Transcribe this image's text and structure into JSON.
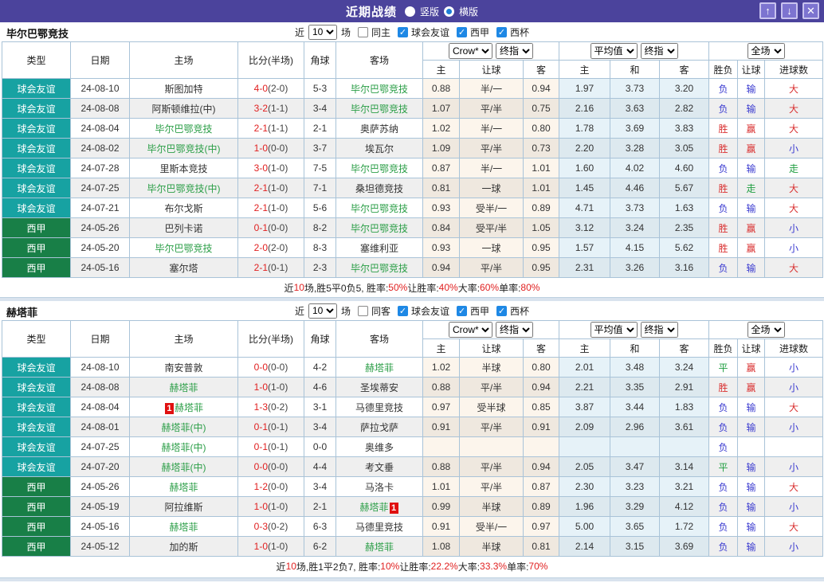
{
  "titlebar": {
    "title": "近期战绩",
    "radio_vertical": "竖版",
    "radio_horizontal": "横版",
    "up_icon": "↑",
    "down_icon": "↓",
    "close_icon": "✕"
  },
  "filters": {
    "near": "近",
    "count": "10",
    "games": "场",
    "friendly": "球会友谊",
    "laliga": "西甲",
    "copa": "西杯"
  },
  "table_header": {
    "type": "类型",
    "date": "日期",
    "home": "主场",
    "score": "比分(半场)",
    "corner": "角球",
    "away": "客场",
    "crow_select": "Crow*",
    "final_select": "终指",
    "avg_select": "平均值",
    "full_select": "全场",
    "h": "主",
    "handicap": "让球",
    "a": "客",
    "d": "和",
    "wl": "胜负",
    "goals": "进球数"
  },
  "sections": [
    {
      "team": "毕尔巴鄂竞技",
      "same_label": "同主",
      "rows": [
        {
          "lg": "球会友谊",
          "lgc": "f",
          "date": "24-08-10",
          "home": "斯图加特",
          "hg": 0,
          "ft": "4-0",
          "ht": "(2-0)",
          "cor": "5-3",
          "away": "毕尔巴鄂竞技",
          "ag": 1,
          "crow": [
            "0.88",
            "半/一",
            "0.94"
          ],
          "avg": [
            "1.97",
            "3.73",
            "3.20"
          ],
          "res": [
            [
              "负",
              "b"
            ],
            [
              "输",
              "b"
            ],
            [
              "大",
              "r"
            ]
          ]
        },
        {
          "lg": "球会友谊",
          "lgc": "f",
          "date": "24-08-08",
          "home": "阿斯顿维拉(中)",
          "hg": 0,
          "ft": "3-2",
          "ht": "(1-1)",
          "cor": "3-4",
          "away": "毕尔巴鄂竞技",
          "ag": 1,
          "crow": [
            "1.07",
            "平/半",
            "0.75"
          ],
          "avg": [
            "2.16",
            "3.63",
            "2.82"
          ],
          "res": [
            [
              "负",
              "b"
            ],
            [
              "输",
              "b"
            ],
            [
              "大",
              "r"
            ]
          ]
        },
        {
          "lg": "球会友谊",
          "lgc": "f",
          "date": "24-08-04",
          "home": "毕尔巴鄂竞技",
          "hg": 1,
          "ft": "2-1",
          "ht": "(1-1)",
          "cor": "2-1",
          "away": "奥萨苏纳",
          "ag": 0,
          "crow": [
            "1.02",
            "半/一",
            "0.80"
          ],
          "avg": [
            "1.78",
            "3.69",
            "3.83"
          ],
          "res": [
            [
              "胜",
              "r"
            ],
            [
              "赢",
              "r"
            ],
            [
              "大",
              "r"
            ]
          ]
        },
        {
          "lg": "球会友谊",
          "lgc": "f",
          "date": "24-08-02",
          "home": "毕尔巴鄂竞技(中)",
          "hg": 1,
          "ft": "1-0",
          "ht": "(0-0)",
          "cor": "3-7",
          "away": "埃瓦尔",
          "ag": 0,
          "crow": [
            "1.09",
            "平/半",
            "0.73"
          ],
          "avg": [
            "2.20",
            "3.28",
            "3.05"
          ],
          "res": [
            [
              "胜",
              "r"
            ],
            [
              "赢",
              "r"
            ],
            [
              "小",
              "b"
            ]
          ]
        },
        {
          "lg": "球会友谊",
          "lgc": "f",
          "date": "24-07-28",
          "home": "里斯本竞技",
          "hg": 0,
          "ft": "3-0",
          "ht": "(1-0)",
          "cor": "7-5",
          "away": "毕尔巴鄂竞技",
          "ag": 1,
          "crow": [
            "0.87",
            "半/一",
            "1.01"
          ],
          "avg": [
            "1.60",
            "4.02",
            "4.60"
          ],
          "res": [
            [
              "负",
              "b"
            ],
            [
              "输",
              "b"
            ],
            [
              "走",
              "g"
            ]
          ]
        },
        {
          "lg": "球会友谊",
          "lgc": "f",
          "date": "24-07-25",
          "home": "毕尔巴鄂竞技(中)",
          "hg": 1,
          "ft": "2-1",
          "ht": "(1-0)",
          "cor": "7-1",
          "away": "桑坦德竞技",
          "ag": 0,
          "crow": [
            "0.81",
            "一球",
            "1.01"
          ],
          "avg": [
            "1.45",
            "4.46",
            "5.67"
          ],
          "res": [
            [
              "胜",
              "r"
            ],
            [
              "走",
              "g"
            ],
            [
              "大",
              "r"
            ]
          ]
        },
        {
          "lg": "球会友谊",
          "lgc": "f",
          "date": "24-07-21",
          "home": "布尔戈斯",
          "hg": 0,
          "ft": "2-1",
          "ht": "(1-0)",
          "cor": "5-6",
          "away": "毕尔巴鄂竞技",
          "ag": 1,
          "crow": [
            "0.93",
            "受半/一",
            "0.89"
          ],
          "avg": [
            "4.71",
            "3.73",
            "1.63"
          ],
          "res": [
            [
              "负",
              "b"
            ],
            [
              "输",
              "b"
            ],
            [
              "大",
              "r"
            ]
          ]
        },
        {
          "lg": "西甲",
          "lgc": "l",
          "date": "24-05-26",
          "home": "巴列卡诺",
          "hg": 0,
          "ft": "0-1",
          "ht": "(0-0)",
          "cor": "8-2",
          "away": "毕尔巴鄂竞技",
          "ag": 1,
          "crow": [
            "0.84",
            "受平/半",
            "1.05"
          ],
          "avg": [
            "3.12",
            "3.24",
            "2.35"
          ],
          "res": [
            [
              "胜",
              "r"
            ],
            [
              "赢",
              "r"
            ],
            [
              "小",
              "b"
            ]
          ]
        },
        {
          "lg": "西甲",
          "lgc": "l",
          "date": "24-05-20",
          "home": "毕尔巴鄂竞技",
          "hg": 1,
          "ft": "2-0",
          "ht": "(2-0)",
          "cor": "8-3",
          "away": "塞维利亚",
          "ag": 0,
          "crow": [
            "0.93",
            "一球",
            "0.95"
          ],
          "avg": [
            "1.57",
            "4.15",
            "5.62"
          ],
          "res": [
            [
              "胜",
              "r"
            ],
            [
              "赢",
              "r"
            ],
            [
              "小",
              "b"
            ]
          ]
        },
        {
          "lg": "西甲",
          "lgc": "l",
          "date": "24-05-16",
          "home": "塞尔塔",
          "hg": 0,
          "ft": "2-1",
          "ht": "(0-1)",
          "cor": "2-3",
          "away": "毕尔巴鄂竞技",
          "ag": 1,
          "crow": [
            "0.94",
            "平/半",
            "0.95"
          ],
          "avg": [
            "2.31",
            "3.26",
            "3.16"
          ],
          "res": [
            [
              "负",
              "b"
            ],
            [
              "输",
              "b"
            ],
            [
              "大",
              "r"
            ]
          ]
        }
      ],
      "summary": [
        [
          "近",
          ""
        ],
        [
          "10",
          "r"
        ],
        [
          "场,胜5平0负5, 胜率:",
          ""
        ],
        [
          "50%",
          "r"
        ],
        [
          " 让胜率:",
          ""
        ],
        [
          "40%",
          "r"
        ],
        [
          " 大率:",
          ""
        ],
        [
          "60%",
          "r"
        ],
        [
          " 单率:",
          ""
        ],
        [
          "80%",
          "r"
        ]
      ]
    },
    {
      "team": "赫塔菲",
      "same_label": "同客",
      "rows": [
        {
          "lg": "球会友谊",
          "lgc": "f",
          "date": "24-08-10",
          "home": "南安普敦",
          "hg": 0,
          "ft": "0-0",
          "ht": "(0-0)",
          "cor": "4-2",
          "away": "赫塔菲",
          "ag": 1,
          "crow": [
            "1.02",
            "半球",
            "0.80"
          ],
          "avg": [
            "2.01",
            "3.48",
            "3.24"
          ],
          "res": [
            [
              "平",
              "g"
            ],
            [
              "赢",
              "r"
            ],
            [
              "小",
              "b"
            ]
          ]
        },
        {
          "lg": "球会友谊",
          "lgc": "f",
          "date": "24-08-08",
          "home": "赫塔菲",
          "hg": 1,
          "ft": "1-0",
          "ht": "(1-0)",
          "cor": "4-6",
          "away": "圣埃蒂安",
          "ag": 0,
          "crow": [
            "0.88",
            "平/半",
            "0.94"
          ],
          "avg": [
            "2.21",
            "3.35",
            "2.91"
          ],
          "res": [
            [
              "胜",
              "r"
            ],
            [
              "赢",
              "r"
            ],
            [
              "小",
              "b"
            ]
          ]
        },
        {
          "lg": "球会友谊",
          "lgc": "f",
          "date": "24-08-04",
          "home": "赫塔菲",
          "hg": 1,
          "hbadge": "1",
          "ft": "1-3",
          "ht": "(0-2)",
          "cor": "3-1",
          "away": "马德里竞技",
          "ag": 0,
          "crow": [
            "0.97",
            "受半球",
            "0.85"
          ],
          "avg": [
            "3.87",
            "3.44",
            "1.83"
          ],
          "res": [
            [
              "负",
              "b"
            ],
            [
              "输",
              "b"
            ],
            [
              "大",
              "r"
            ]
          ]
        },
        {
          "lg": "球会友谊",
          "lgc": "f",
          "date": "24-08-01",
          "home": "赫塔菲(中)",
          "hg": 1,
          "ft": "0-1",
          "ht": "(0-1)",
          "cor": "3-4",
          "away": "萨拉戈萨",
          "ag": 0,
          "crow": [
            "0.91",
            "平/半",
            "0.91"
          ],
          "avg": [
            "2.09",
            "2.96",
            "3.61"
          ],
          "res": [
            [
              "负",
              "b"
            ],
            [
              "输",
              "b"
            ],
            [
              "小",
              "b"
            ]
          ]
        },
        {
          "lg": "球会友谊",
          "lgc": "f",
          "date": "24-07-25",
          "home": "赫塔菲(中)",
          "hg": 1,
          "ft": "0-1",
          "ht": "(0-1)",
          "cor": "0-0",
          "away": "奥维多",
          "ag": 0,
          "crow": [
            "",
            "",
            ""
          ],
          "avg": [
            "",
            "",
            ""
          ],
          "res": [
            [
              "负",
              "b"
            ],
            [
              "",
              ""
            ],
            [
              "",
              ""
            ]
          ]
        },
        {
          "lg": "球会友谊",
          "lgc": "f",
          "date": "24-07-20",
          "home": "赫塔菲(中)",
          "hg": 1,
          "ft": "0-0",
          "ht": "(0-0)",
          "cor": "4-4",
          "away": "考文垂",
          "ag": 0,
          "crow": [
            "0.88",
            "平/半",
            "0.94"
          ],
          "avg": [
            "2.05",
            "3.47",
            "3.14"
          ],
          "res": [
            [
              "平",
              "g"
            ],
            [
              "输",
              "b"
            ],
            [
              "小",
              "b"
            ]
          ]
        },
        {
          "lg": "西甲",
          "lgc": "l",
          "date": "24-05-26",
          "home": "赫塔菲",
          "hg": 1,
          "ft": "1-2",
          "ht": "(0-0)",
          "cor": "3-4",
          "away": "马洛卡",
          "ag": 0,
          "crow": [
            "1.01",
            "平/半",
            "0.87"
          ],
          "avg": [
            "2.30",
            "3.23",
            "3.21"
          ],
          "res": [
            [
              "负",
              "b"
            ],
            [
              "输",
              "b"
            ],
            [
              "大",
              "r"
            ]
          ]
        },
        {
          "lg": "西甲",
          "lgc": "l",
          "date": "24-05-19",
          "home": "阿拉维斯",
          "hg": 0,
          "ft": "1-0",
          "ht": "(1-0)",
          "cor": "2-1",
          "away": "赫塔菲",
          "ag": 1,
          "abadge": "1",
          "crow": [
            "0.99",
            "半球",
            "0.89"
          ],
          "avg": [
            "1.96",
            "3.29",
            "4.12"
          ],
          "res": [
            [
              "负",
              "b"
            ],
            [
              "输",
              "b"
            ],
            [
              "小",
              "b"
            ]
          ]
        },
        {
          "lg": "西甲",
          "lgc": "l",
          "date": "24-05-16",
          "home": "赫塔菲",
          "hg": 1,
          "ft": "0-3",
          "ht": "(0-2)",
          "cor": "6-3",
          "away": "马德里竞技",
          "ag": 0,
          "crow": [
            "0.91",
            "受半/一",
            "0.97"
          ],
          "avg": [
            "5.00",
            "3.65",
            "1.72"
          ],
          "res": [
            [
              "负",
              "b"
            ],
            [
              "输",
              "b"
            ],
            [
              "大",
              "r"
            ]
          ]
        },
        {
          "lg": "西甲",
          "lgc": "l",
          "date": "24-05-12",
          "home": "加的斯",
          "hg": 0,
          "ft": "1-0",
          "ht": "(1-0)",
          "cor": "6-2",
          "away": "赫塔菲",
          "ag": 1,
          "crow": [
            "1.08",
            "半球",
            "0.81"
          ],
          "avg": [
            "2.14",
            "3.15",
            "3.69"
          ],
          "res": [
            [
              "负",
              "b"
            ],
            [
              "输",
              "b"
            ],
            [
              "小",
              "b"
            ]
          ]
        }
      ],
      "summary": [
        [
          "近",
          ""
        ],
        [
          "10",
          "r"
        ],
        [
          "场,胜1平2负7, 胜率:",
          ""
        ],
        [
          "10%",
          "r"
        ],
        [
          " 让胜率:",
          ""
        ],
        [
          "22.2%",
          "r"
        ],
        [
          " 大率:",
          ""
        ],
        [
          "33.3%",
          "r"
        ],
        [
          " 单率:",
          ""
        ],
        [
          "70%",
          "r"
        ]
      ]
    }
  ],
  "colors": {
    "titlebar": "#4b439c",
    "friendly_badge": "#17a2a2",
    "laliga_badge": "#187f47",
    "team_highlight": "#2b9e47",
    "win_red": "#d93030",
    "lose_blue": "#3a3ad0",
    "draw_green": "#1f9e40",
    "summary_red": "#e02020"
  }
}
